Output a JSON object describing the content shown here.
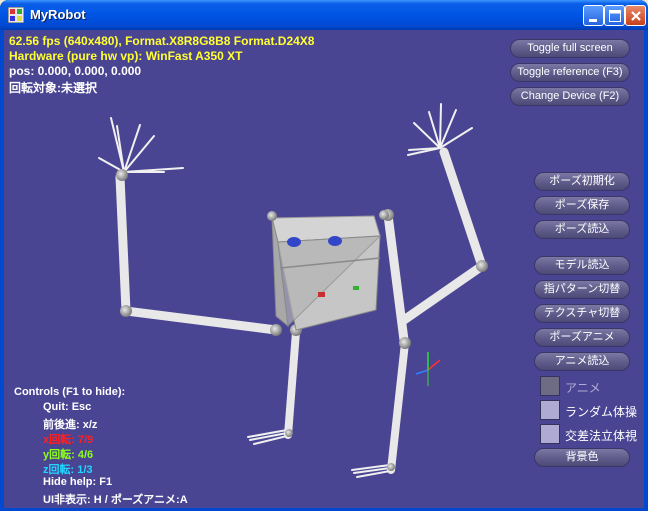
{
  "window": {
    "title": "MyRobot",
    "titlebar_color": "#0055e5"
  },
  "stats": {
    "line1": "62.56 fps (640x480), Format.X8R8G8B8 Format.D24X8",
    "line2": "Hardware (pure hw vp): WinFast A350 XT",
    "line3": "pos:  0.000,  0.000,  0.000",
    "line4": "回転対象:未選択"
  },
  "buttons_top": [
    "Toggle full screen",
    "Toggle reference (F3)",
    "Change Device (F2)"
  ],
  "pose_buttons": [
    "ポーズ初期化",
    "ポーズ保存",
    "ポーズ読込"
  ],
  "model_buttons": [
    "モデル読込",
    "指パターン切替",
    "テクスチャ切替",
    "ポーズアニメ",
    "アニメ読込"
  ],
  "checkboxes": [
    {
      "label": "アニメ",
      "checked": true
    },
    {
      "label": "ランダム体操",
      "checked": false
    },
    {
      "label": "交差法立体視",
      "checked": false
    }
  ],
  "color_button": "背景色",
  "help": {
    "title": "Controls (F1 to hide):",
    "quit": "Quit: Esc",
    "move": "前後進: x/z",
    "xrot": "x回転: 7/9",
    "yrot": "y回転: 4/6",
    "zrot": "z回転: 1/3",
    "hide": "Hide help: F1",
    "ui": "UI非表示: H / ポーズアニメ:A"
  },
  "colors": {
    "background": "#4a4593",
    "stats_yellow": "#ffff33",
    "x_axis_red": "#ff2020",
    "y_axis_green": "#8cff1a",
    "z_axis_cyan": "#22d6ff"
  }
}
